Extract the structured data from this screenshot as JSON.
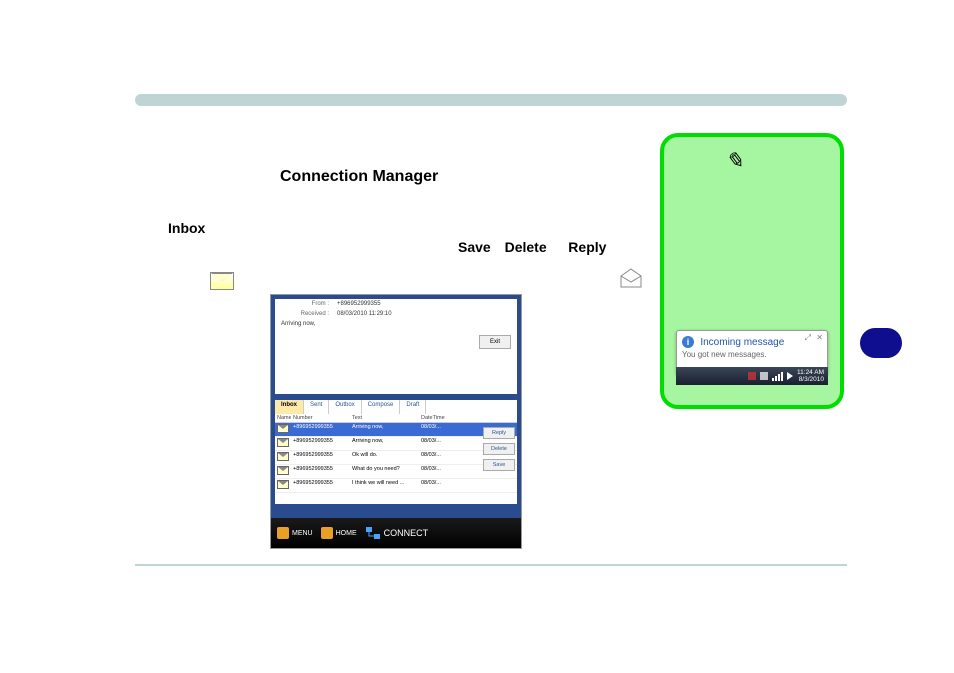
{
  "doc": {
    "title": "Connection Manager",
    "inbox_label": "Inbox",
    "actions": {
      "save": "Save",
      "delete": "Delete",
      "reply": "Reply"
    }
  },
  "screenshot": {
    "from_label": "From :",
    "from_value": "+896952999355",
    "received_label": "Received :",
    "received_value": "08/03/2010 11:29:10",
    "message_body": "Arriving now,",
    "exit": "Exit",
    "tabs": [
      "Inbox",
      "Sent",
      "Outbox",
      "Compose",
      "Draft"
    ],
    "active_tab": 0,
    "columns": {
      "name": "Name",
      "number": "Number",
      "text": "Text",
      "datetime": "DateTime"
    },
    "rows": [
      {
        "number": "+896952999355",
        "text": "Arriving now,",
        "date": "08/03/...",
        "selected": true
      },
      {
        "number": "+896952999355",
        "text": "Arriving now,",
        "date": "08/03/..."
      },
      {
        "number": "+896952999355",
        "text": "Ok will do.",
        "date": "08/03/..."
      },
      {
        "number": "+896952999355",
        "text": "What do you need?",
        "date": "08/03/..."
      },
      {
        "number": "+896952999355",
        "text": "I think we will need ...",
        "date": "08/03/..."
      }
    ],
    "buttons": {
      "reply": "Reply",
      "delete": "Delete",
      "save": "Save"
    },
    "toolbar": {
      "menu": "MENU",
      "home": "HOME",
      "connect": "CONNECT"
    }
  },
  "tray": {
    "popup_title": "Incoming message",
    "popup_text": "You got new messages.",
    "clock_time": "11:24 AM",
    "clock_date": "8/3/2010"
  }
}
